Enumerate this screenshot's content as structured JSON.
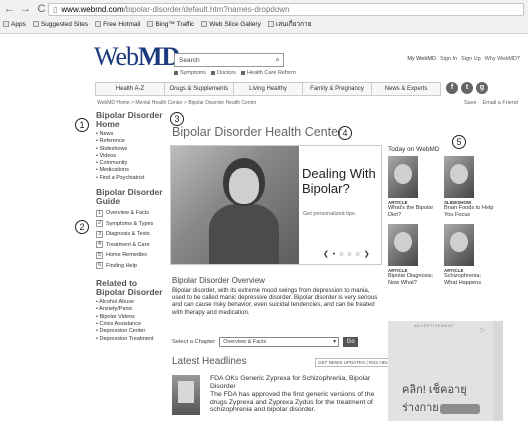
{
  "browser": {
    "url_host": "www.webmd.com",
    "url_path": "/bipolar-disorder/default.htm?names-dropdown",
    "bookmarks": [
      "Apps",
      "Suggested Sites",
      "Free Hotmail",
      "Bing™ Traffic",
      "Web Slice Gallery",
      "เล่นเกี่ยวกาย"
    ]
  },
  "header": {
    "logo_web": "Web",
    "logo_md": "MD",
    "search_placeholder": "Search",
    "sublinks": [
      "Symptoms",
      "Doctors",
      "Health Care Reform"
    ],
    "account_links": [
      "My WebMD",
      "Sign In",
      "Sign Up",
      "Why WebMD?"
    ],
    "tabs": [
      "Health A-Z",
      "Drugs & Supplements",
      "Living Healthy",
      "Family & Pregnancy",
      "News & Experts"
    ],
    "social": [
      "f",
      "t",
      "g"
    ]
  },
  "breadcrumb": "WebMD Home > Mental Health Center > Bipolar Disorder Health Center",
  "save_links": [
    "Save",
    "Email a Friend"
  ],
  "annotations": [
    "1",
    "2",
    "3",
    "4",
    "5"
  ],
  "leftnav": {
    "home_title": "Bipolar Disorder Home",
    "home_items": [
      "News",
      "Reference",
      "Slideshows",
      "Videos",
      "Community",
      "Medications",
      "Find a Psychiatrist"
    ],
    "guide_title": "Bipolar Disorder Guide",
    "guide_items": [
      "Overview & Facts",
      "Symptoms & Types",
      "Diagnosis & Tests",
      "Treatment & Care",
      "Home Remedies",
      "Finding Help"
    ],
    "related_title": "Related to Bipolar Disorder",
    "related_items": [
      "Alcohol Abuse",
      "Anxiety/Panic",
      "Bipolar Videos",
      "Crisis Assistance",
      "Depression Center",
      "Depression Treatment"
    ]
  },
  "main": {
    "title": "Bipolar Disorder Health Center",
    "hero_heading": "Dealing With Bipolar?",
    "hero_sub": "Get personalized tips.",
    "carousel": "❮ • ○ ○ ○ ❯",
    "overview_title": "Bipolar Disorder Overview",
    "overview_text": "Bipolar disorder, with its extreme mood swings from depression to mania, used to be called manic depressive disorder. Bipolar disorder is very serious and can cause risky behavior, even suicidal tendencies, and can be treated with therapy and medication.",
    "chapter_label": "Select a Chapter",
    "chapter_selected": "Overview & Facts",
    "go_label": "Go",
    "headlines_title": "Latest Headlines",
    "headline_links": "GET NEWS UPDATES | RSS HELP",
    "headline_title": "FDA OKs Generic Zyprexa for Schizophrenia, Bipolar Disorder",
    "headline_body": "The FDA has approved the first generic versions of the drugs Zyprexa and Zyprexa Zydus for the treatment of schizophrenia and bipolar disorder."
  },
  "today": {
    "title": "Today on WebMD",
    "cards": [
      {
        "kind": "ARTICLE",
        "title": "What's the Bipolar Diet?"
      },
      {
        "kind": "SLIDESHOW",
        "title": "Brain Foods to Help You Focus"
      },
      {
        "kind": "ARTICLE",
        "title": "Bipolar Diagnosis: Now What?"
      },
      {
        "kind": "ARTICLE",
        "title": "Schizophrenia: What Happens"
      }
    ]
  },
  "ad": {
    "label": "ADVERTISEMENT",
    "text": "คลิก! เช็คอายุร่างกาย"
  }
}
